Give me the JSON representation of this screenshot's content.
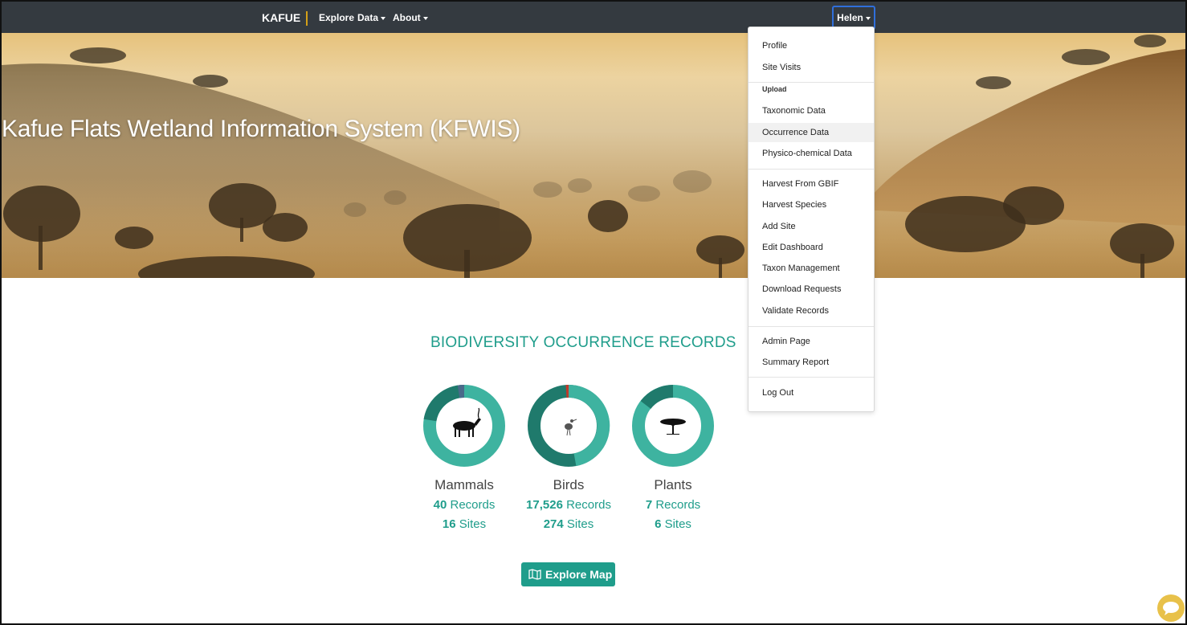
{
  "navbar": {
    "brand": "KAFUE",
    "links": [
      "Explore",
      "Data",
      "About"
    ],
    "user": "Helen"
  },
  "hero": {
    "title": "Kafue Flats Wetland Information System (KFWIS)"
  },
  "records": {
    "title": "BIODIVERSITY OCCURRENCE RECORDS",
    "cards": [
      {
        "label": "Mammals",
        "records": "40",
        "sites": "16",
        "icon": "kudu-icon"
      },
      {
        "label": "Birds",
        "records": "17,526",
        "sites": "274",
        "icon": "bird-icon"
      },
      {
        "label": "Plants",
        "records": "7",
        "sites": "6",
        "icon": "acacia-tree-icon"
      }
    ],
    "records_word": "Records",
    "sites_word": "Sites",
    "explore_button": "Explore Map »"
  },
  "dropdown": {
    "items": [
      "Profile",
      "Site Visits"
    ],
    "upload_header": "Upload",
    "upload_items": [
      "Taxonomic Data",
      "Occurrence Data",
      "Physico-chemical Data"
    ],
    "admin_items": [
      "Harvest From GBIF",
      "Harvest Species",
      "Add Site",
      "Edit Dashboard",
      "Taxon Management",
      "Download Requests",
      "Validate Records"
    ],
    "report_items": [
      "Admin Page",
      "Summary Report"
    ],
    "logout": "Log Out",
    "active": "Occurrence Data"
  },
  "colors": {
    "accent": "#1f9d8b",
    "navbar": "#343a40",
    "donut_light": "#3eb3a0",
    "donut_dark": "#1f7a6c"
  }
}
